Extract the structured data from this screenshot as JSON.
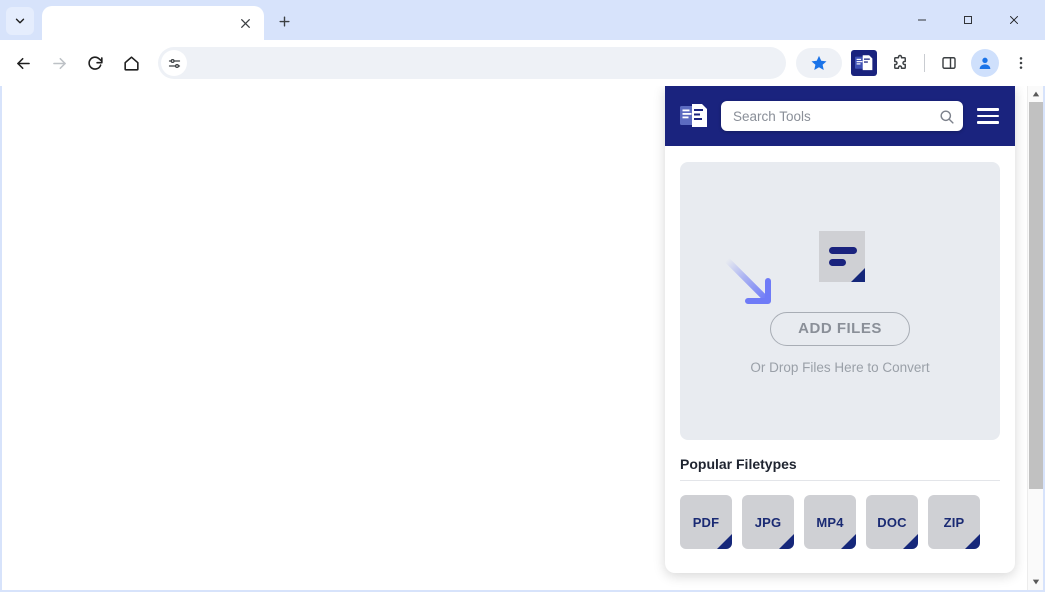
{
  "browser": {
    "tab": {
      "title": "",
      "close_label": "×",
      "search_tabs_icon": "chevron-down-icon"
    },
    "new_tab_label": "+",
    "window_controls": {
      "minimize": "—",
      "maximize": "□",
      "close": "×"
    },
    "nav": {
      "back": "back-arrow-icon",
      "forward": "forward-arrow-icon",
      "reload": "reload-icon",
      "home": "home-icon"
    },
    "omnibox": {
      "value": "",
      "placeholder": "",
      "leading_icon": "tune-sliders-icon"
    },
    "toolbar_icons": {
      "bookmark_star": "star-filled-icon",
      "extension_app": "file-converter-logo-icon",
      "extensions_puzzle": "puzzle-piece-icon",
      "side_panel": "side-panel-icon",
      "profile": "profile-avatar-icon",
      "menu": "three-dot-menu-icon"
    }
  },
  "panel": {
    "header": {
      "logo_icon": "file-converter-logo-icon",
      "search_placeholder": "Search Tools",
      "search_value": "",
      "search_icon": "magnifier-icon",
      "menu_icon": "hamburger-menu-icon"
    },
    "dropzone": {
      "arrow_icon": "down-right-arrow-icon",
      "document_icon": "document-file-icon",
      "add_files_label": "ADD FILES",
      "drop_hint": "Or Drop Files Here to Convert"
    },
    "popular": {
      "title": "Popular Filetypes",
      "items": [
        {
          "label": "PDF"
        },
        {
          "label": "JPG"
        },
        {
          "label": "MP4"
        },
        {
          "label": "DOC"
        },
        {
          "label": "ZIP"
        }
      ]
    }
  },
  "colors": {
    "brand_navy": "#1a237e",
    "dropzone_bg": "#e8ebf0",
    "card_grey": "#cfd0d4",
    "label_navy": "#1a2a73",
    "arrow_blue": "#7b83f0"
  }
}
